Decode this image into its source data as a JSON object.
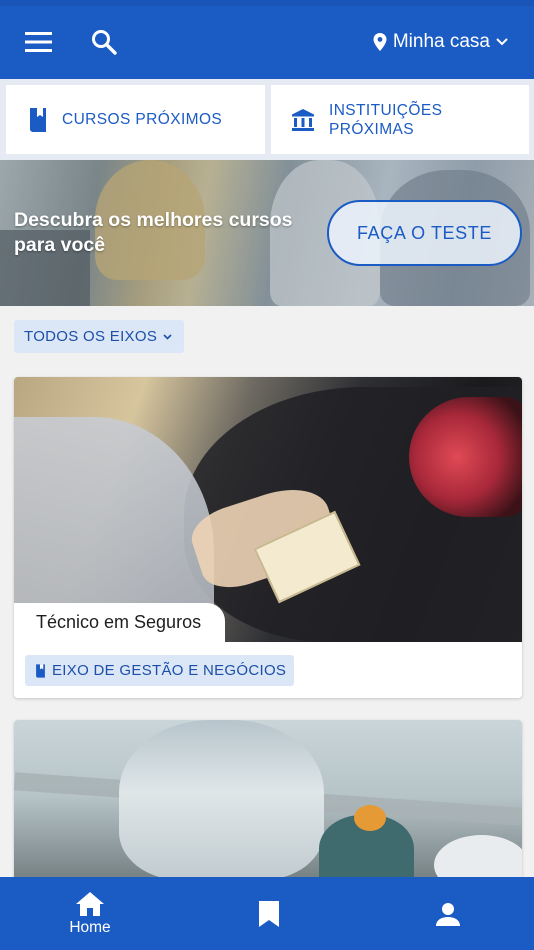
{
  "colors": {
    "primary": "#1b5bc4",
    "chip_bg": "#dbe6f6",
    "chip_text": "#1b4fa8"
  },
  "topbar": {
    "menu_icon": "menu-icon",
    "search_icon": "search-icon",
    "location_label": "Minha casa"
  },
  "shortcuts": [
    {
      "label": "CURSOS PRÓXIMOS",
      "icon": "book-icon"
    },
    {
      "label": "INSTITUIÇÕES\nPRÓXIMAS",
      "icon": "institution-icon"
    }
  ],
  "hero": {
    "tagline": "Descubra os melhores cursos para você",
    "cta_label": "FAÇA O TESTE"
  },
  "filter": {
    "label": "TODOS OS EIXOS"
  },
  "courses": [
    {
      "title": "Técnico em Seguros",
      "axis": "EIXO DE GESTÃO E NEGÓCIOS"
    }
  ],
  "bottom_nav": {
    "home_label": "Home"
  }
}
